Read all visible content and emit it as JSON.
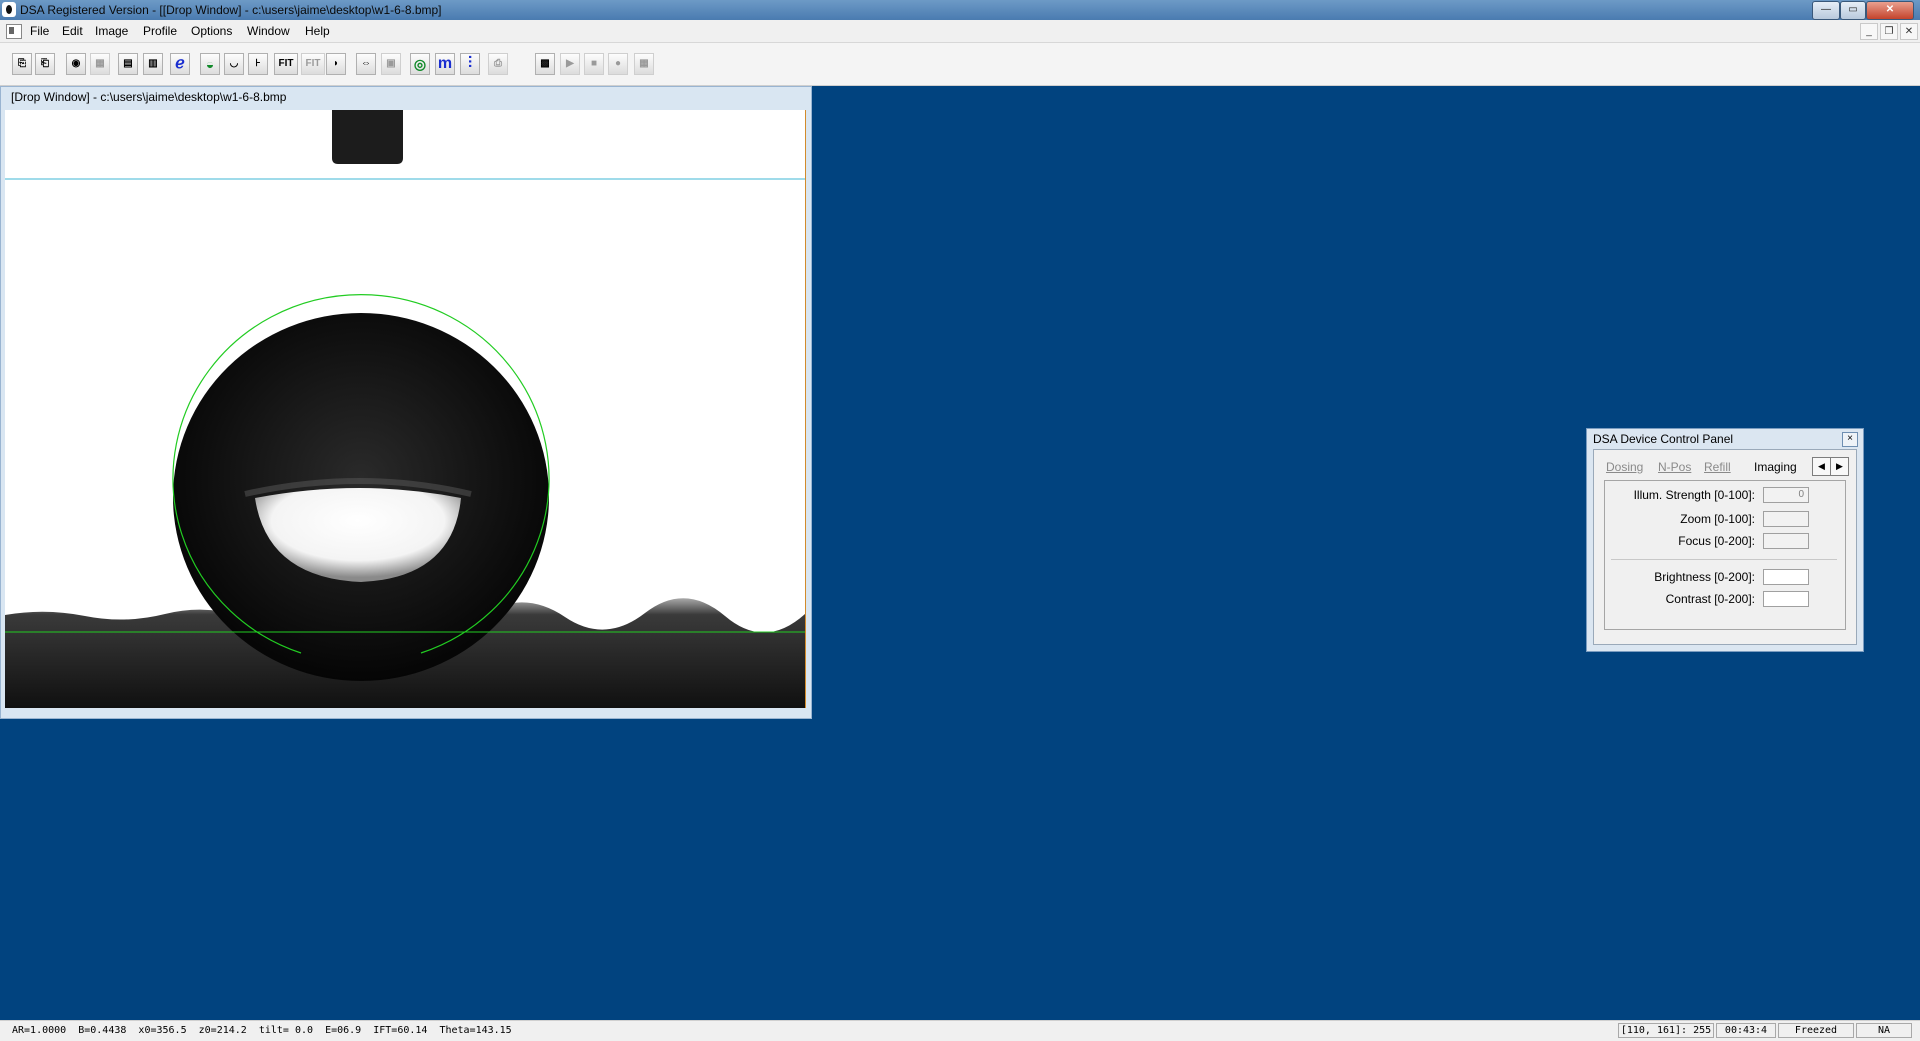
{
  "window": {
    "title": "DSA Registered Version - [[Drop Window] - c:\\users\\jaime\\desktop\\w1-6-8.bmp]",
    "caption_buttons": {
      "minimize": "—",
      "maximize": "▭",
      "close": "✕"
    }
  },
  "menubar": {
    "items": [
      "File",
      "Edit",
      "Image",
      "Profile",
      "Options",
      "Window",
      "Help"
    ],
    "mdi_buttons": {
      "minimize": "_",
      "restore": "❐",
      "close": "✕"
    }
  },
  "toolbar": {
    "buttons": [
      {
        "icon": "open-icon",
        "glyph": "⎘"
      },
      {
        "icon": "save-icon",
        "glyph": "⎗"
      },
      {
        "icon": "drop-icon",
        "glyph": "◉"
      },
      {
        "icon": "copy-icon",
        "glyph": "▦"
      },
      {
        "icon": "table-icon",
        "glyph": "▤"
      },
      {
        "icon": "chart-icon",
        "glyph": "▥"
      },
      {
        "icon": "script-icon",
        "glyph": "ℯ"
      },
      {
        "icon": "sessile-drop-icon",
        "glyph": "◒"
      },
      {
        "icon": "pendant-drop-icon",
        "glyph": "◡"
      },
      {
        "icon": "baseline-icon",
        "glyph": "⊦"
      },
      {
        "icon": "fit-icon",
        "glyph": "FIT"
      },
      {
        "icon": "fit-disabled-icon",
        "glyph": "FIT"
      },
      {
        "icon": "drop-shape-icon",
        "glyph": "◗"
      },
      {
        "icon": "needle-width-icon",
        "glyph": "⇔"
      },
      {
        "icon": "measure-icon",
        "glyph": "▣"
      },
      {
        "icon": "camera-icon",
        "glyph": "◎"
      },
      {
        "icon": "magnify-icon",
        "glyph": "m"
      },
      {
        "icon": "needle-icon",
        "glyph": "⫶"
      },
      {
        "icon": "print-icon",
        "glyph": "⎙"
      },
      {
        "icon": "video-icon",
        "glyph": "▩"
      },
      {
        "icon": "play-icon",
        "glyph": "▶"
      },
      {
        "icon": "stop-icon",
        "glyph": "■"
      },
      {
        "icon": "record-icon",
        "glyph": "●"
      },
      {
        "icon": "grid-icon",
        "glyph": "▦"
      }
    ],
    "fit_label": "FIT"
  },
  "drop_window": {
    "title": "[Drop Window] - c:\\users\\jaime\\desktop\\w1-6-8.bmp"
  },
  "device_panel": {
    "title": "DSA Device Control Panel",
    "close": "×",
    "tabs": [
      "Dosing",
      "N-Pos",
      "Refill",
      "Imaging"
    ],
    "active_tab": "Imaging",
    "arrows": {
      "left": "◀",
      "right": "▶"
    },
    "fields": [
      {
        "label": "Illum. Strength [0-100]:",
        "value": "0"
      },
      {
        "label": "Zoom [0-100]:",
        "value": ""
      },
      {
        "label": "Focus [0-200]:",
        "value": ""
      },
      {
        "label": "Brightness [0-200]:",
        "value": ""
      },
      {
        "label": "Contrast [0-200]:",
        "value": ""
      }
    ]
  },
  "statusbar": {
    "main": "AR=1.0000  B=0.4438  x0=356.5  z0=214.2  tilt= 0.0  E=06.9  IFT=60.14  Theta=143.15",
    "cursor": "[110, 161]:  255",
    "time": "00:43:4",
    "state": "Freezed",
    "extra": "NA"
  },
  "colors": {
    "desktop": "#01437f",
    "fit_line": "#22cc22",
    "baseline_marker": "#3fb7d6"
  }
}
